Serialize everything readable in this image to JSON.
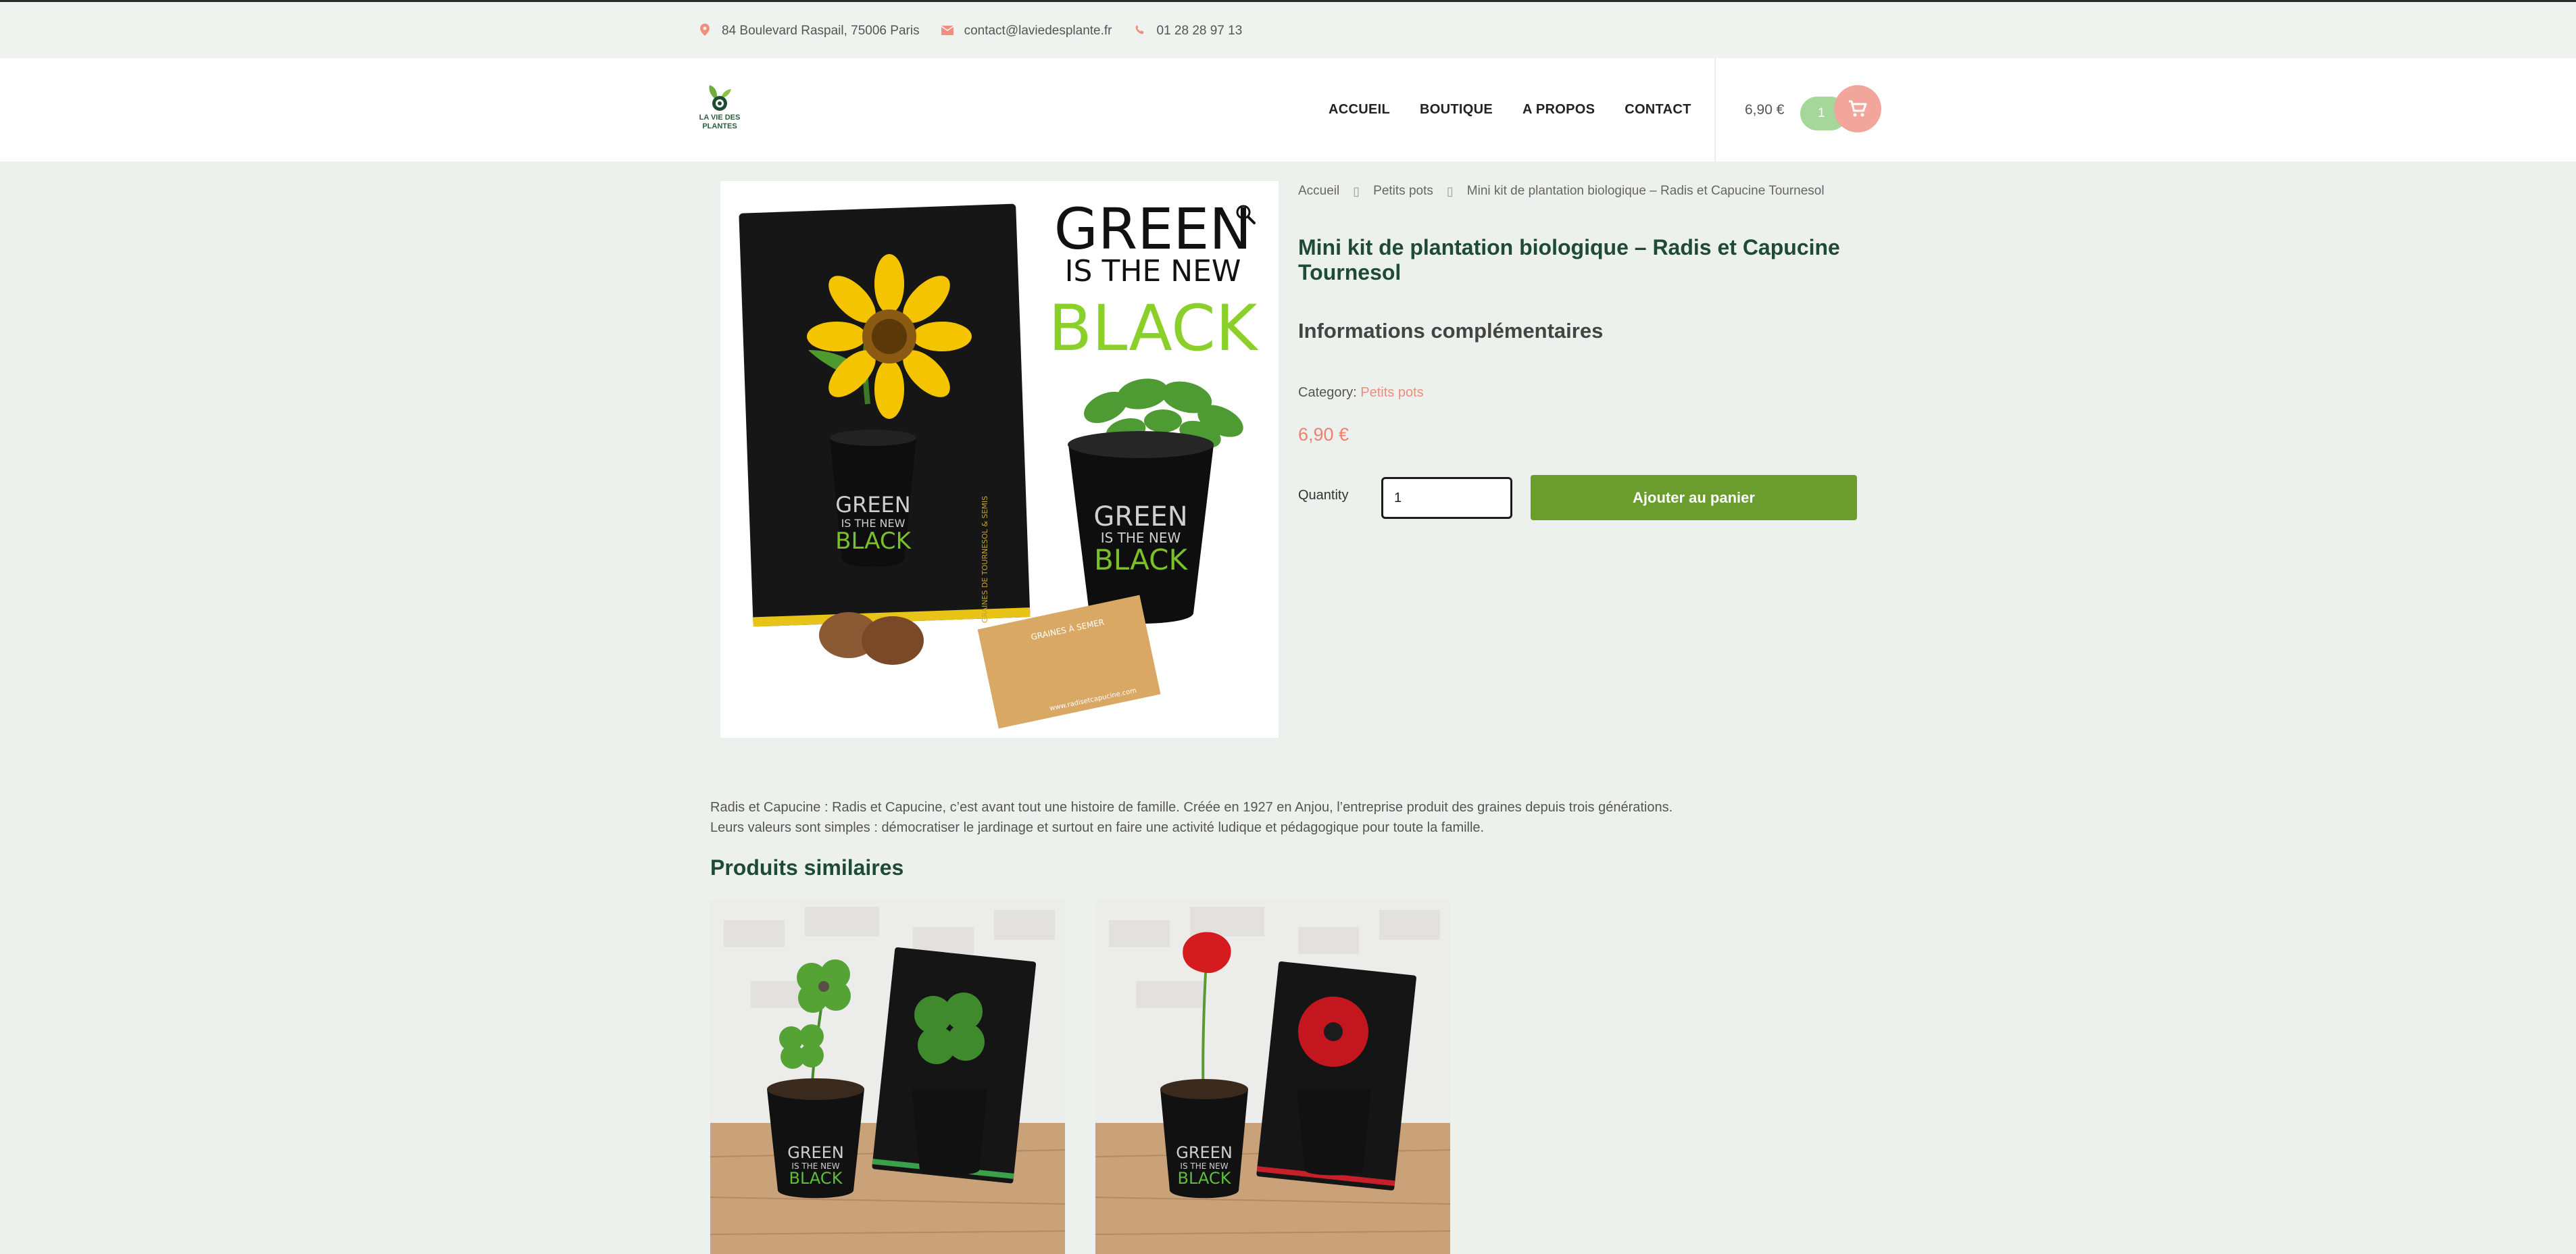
{
  "topbar": {
    "address": "84 Boulevard Raspail, 75006 Paris",
    "email": "contact@laviedesplante.fr",
    "phone": "01 28 28 97 13",
    "icon_color": "#f08f80"
  },
  "header": {
    "logo_text": "LA VIE DES PLANTES",
    "nav": [
      "ACCUEIL",
      "BOUTIQUE",
      "A PROPOS",
      "CONTACT"
    ],
    "cart_total": "6,90 €",
    "cart_count": "1"
  },
  "product": {
    "image_texts": {
      "headline_1": "GREEN",
      "headline_2": "IS THE NEW",
      "headline_3": "BLACK",
      "card_text": "GRAINES DE TOURNESOL & SEMIS",
      "packet_text": "GRAINES À SEMER",
      "packet_url": "www.radisetcapucine.com"
    },
    "breadcrumb": [
      "Accueil",
      "Petits pots",
      "Mini kit de plantation biologique – Radis et Capucine Tournesol"
    ],
    "title": "Mini kit de plantation biologique – Radis et Capucine Tournesol",
    "info_heading": "Informations complémentaires",
    "category_label": "Category:",
    "category_value": "Petits pots",
    "price": "6,90 €",
    "quantity_label": "Quantity",
    "quantity_value": "1",
    "add_to_cart_label": "Ajouter au panier"
  },
  "description": {
    "line1": "Radis et Capucine : Radis et Capucine, c’est avant tout une histoire de famille. Créée en 1927 en Anjou, l’entreprise produit des graines depuis trois générations.",
    "line2": "Leurs valeurs sont simples : démocratiser le jardinage et surtout en faire une activité ludique et pédagogique pour toute la famille."
  },
  "related": {
    "heading": "Produits similaires",
    "pot_text_1": "GREEN",
    "pot_text_2": "IS THE NEW",
    "pot_text_3": "BLACK",
    "items": [
      "clover",
      "poppy"
    ]
  },
  "colors": {
    "page_bg": "#ecf1ed",
    "accent_green": "#6b9c2e",
    "title_green": "#1f4a34",
    "price_coral": "#ef7f6e",
    "cart_pink": "#f2a59b",
    "cart_green": "#a5d69a"
  }
}
